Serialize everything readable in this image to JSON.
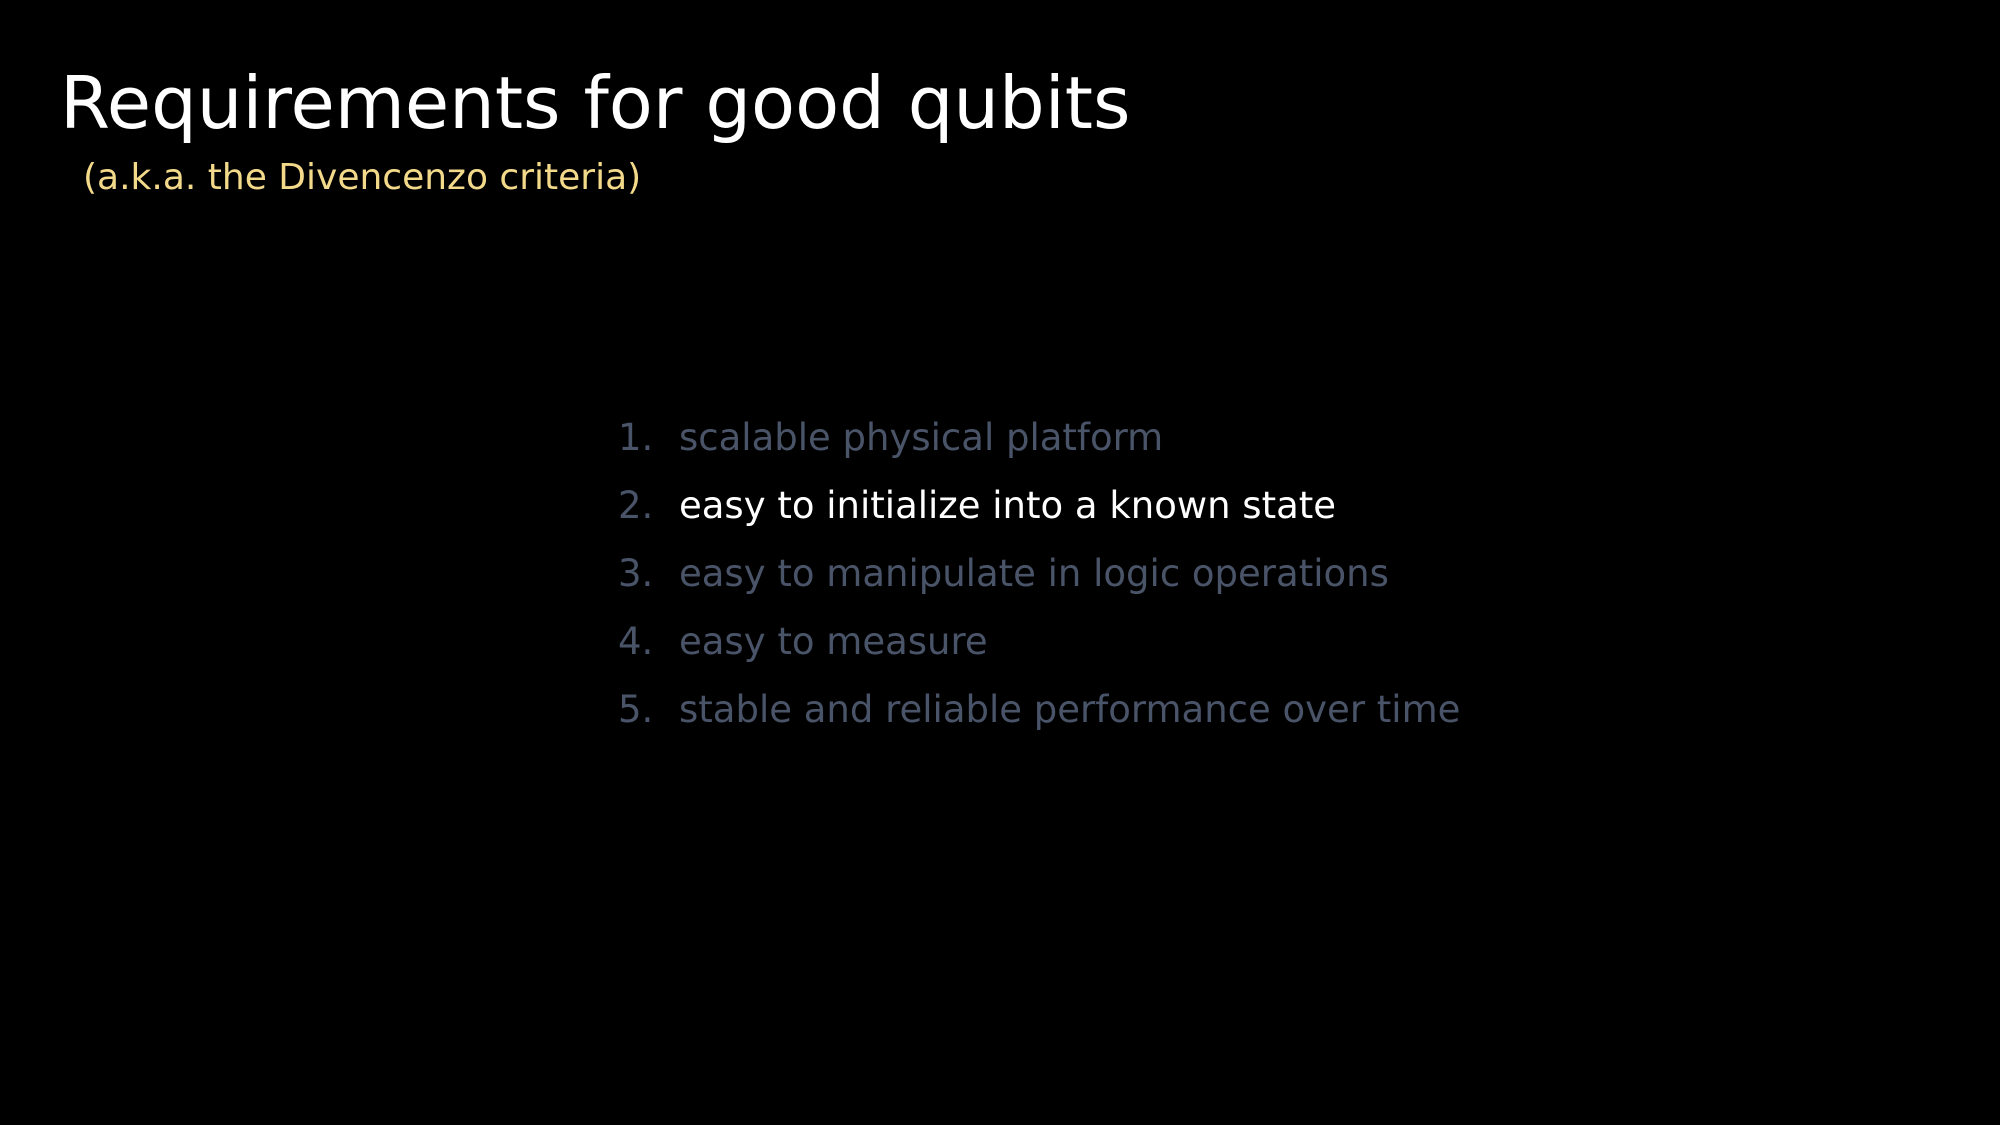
{
  "slide": {
    "title": "Requirements for good qubits",
    "subtitle": "(a.k.a. the Divencenzo criteria)"
  },
  "colors": {
    "background": "#000000",
    "title": "#ffffff",
    "subtitle": "#f3d98a",
    "dimmed": "#4a5468",
    "highlighted": "#ffffff"
  },
  "criteria": [
    {
      "number": "1.",
      "text": "scalable physical platform",
      "highlighted": false
    },
    {
      "number": "2.",
      "text": "easy to initialize into a known state",
      "highlighted": true
    },
    {
      "number": "3.",
      "text": "easy to manipulate in logic operations",
      "highlighted": false
    },
    {
      "number": "4.",
      "text": "easy to measure",
      "highlighted": false
    },
    {
      "number": "5.",
      "text": "stable and reliable performance over time",
      "highlighted": false
    }
  ]
}
